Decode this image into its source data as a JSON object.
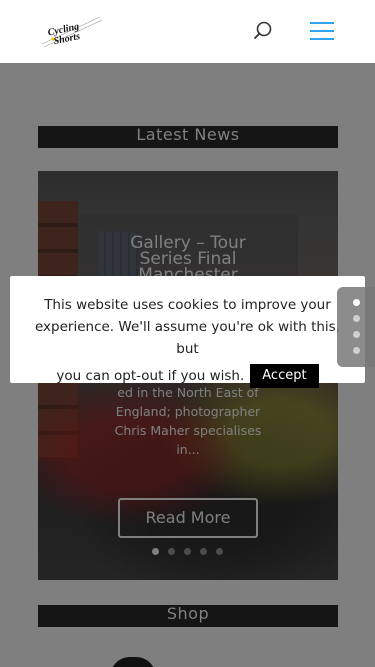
{
  "header": {
    "logo_line1": "Cycling",
    "logo_line2": "Shorts"
  },
  "sections": {
    "latest_news": "Latest News",
    "shop": "Shop"
  },
  "slide": {
    "title_line1": "Gallery – Tour",
    "title_line2": "Series Final",
    "title_line3": "Manchester",
    "excerpt_line1": "ed in the North East of",
    "excerpt_line2": "England; photographer",
    "excerpt_line3": "Chris Maher specialises",
    "excerpt_line4": "in...",
    "read_more": "Read More"
  },
  "cookie": {
    "line1": "This website uses cookies to improve your",
    "line2": "experience. We'll assume you're ok with this, but",
    "line3": "you can opt-out if you wish.",
    "accept": "Accept"
  },
  "colors": {
    "accent": "#2ea3f2",
    "section_bar": "#2a2a2a",
    "overlay": "rgba(0,0,0,0.5)"
  }
}
